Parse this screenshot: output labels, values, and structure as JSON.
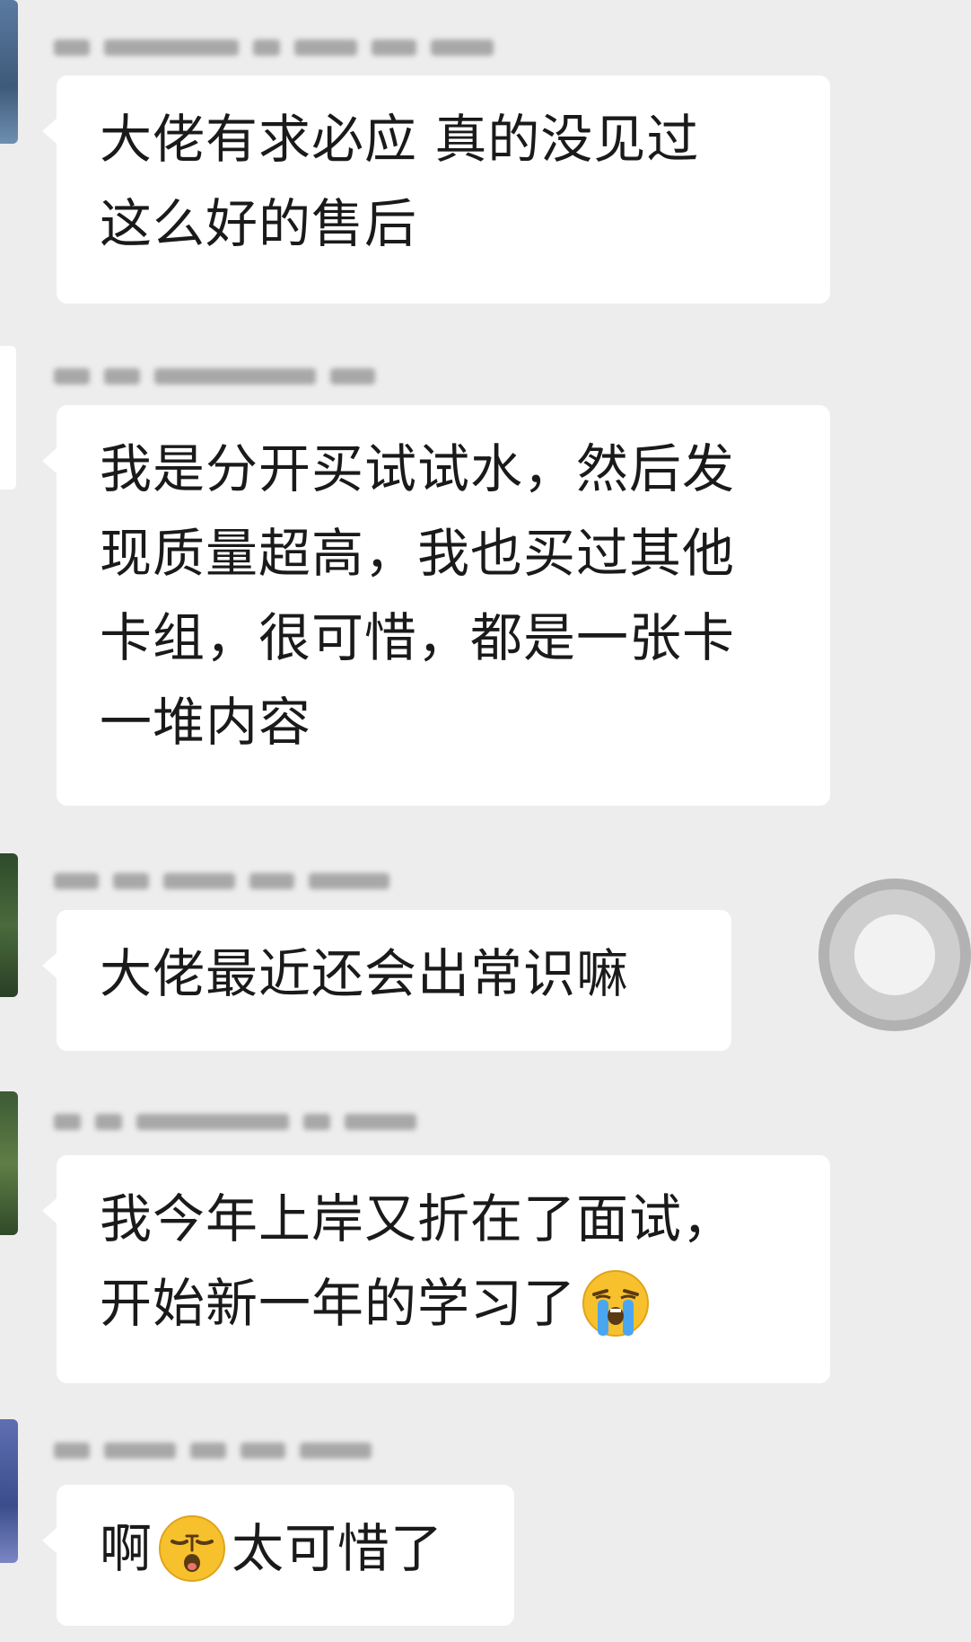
{
  "messages": [
    {
      "lines": [
        "大佬有求必应 真的没见过",
        "这么好的售后"
      ]
    },
    {
      "lines": [
        "我是分开买试试水，然后发",
        "现质量超高，我也买过其他",
        "卡组，很可惜，都是一张卡",
        "一堆内容"
      ]
    },
    {
      "lines": [
        "大佬最近还会出常识嘛"
      ]
    },
    {
      "lines": [
        "我今年上岸又折在了面试，",
        "开始新一年的学习了"
      ],
      "emoji": "loudly-crying-face"
    },
    {
      "prefix": "啊",
      "emoji": "sleepy-face",
      "suffix": "太可惜了"
    }
  ],
  "colors": {
    "background": "#ededed",
    "bubble": "#ffffff",
    "text": "#1a1a1a"
  }
}
